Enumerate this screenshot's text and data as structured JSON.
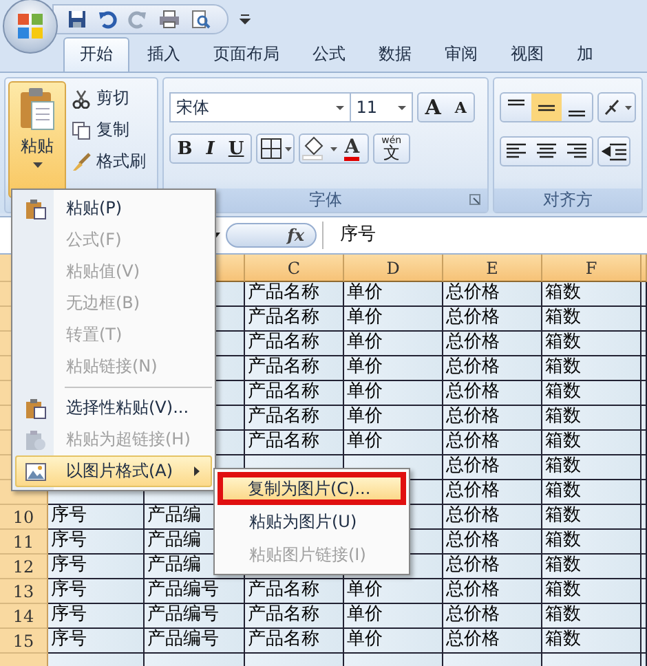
{
  "tabs": [
    {
      "label": "开始",
      "selected": true
    },
    {
      "label": "插入",
      "selected": false
    },
    {
      "label": "页面布局",
      "selected": false
    },
    {
      "label": "公式",
      "selected": false
    },
    {
      "label": "数据",
      "selected": false
    },
    {
      "label": "审阅",
      "selected": false
    },
    {
      "label": "视图",
      "selected": false
    },
    {
      "label": "加",
      "selected": false
    }
  ],
  "clipboard": {
    "paste": "粘贴",
    "tools": [
      {
        "label": "剪切",
        "kind": "cut"
      },
      {
        "label": "复制",
        "kind": "copy"
      },
      {
        "label": "格式刷",
        "kind": "brush"
      }
    ]
  },
  "font": {
    "name": "宋体",
    "size": "11",
    "grow": "A",
    "shrink": "A",
    "bold": "B",
    "italic": "I",
    "underline": "U",
    "color_letter": "A",
    "phonetic_top": "wén",
    "phonetic": "文",
    "label": "字体"
  },
  "alignment": {
    "label": "对齐方"
  },
  "formula_bar": {
    "fx": "fx",
    "content": "序号"
  },
  "columns": [
    null,
    null,
    "C",
    "D",
    "E",
    "F"
  ],
  "rows": [
    {
      "number": null,
      "cells": [
        null,
        null,
        "产品名称",
        "单价",
        "总价格",
        "箱数"
      ]
    },
    {
      "number": null,
      "cells": [
        null,
        null,
        "产品名称",
        "单价",
        "总价格",
        "箱数"
      ]
    },
    {
      "number": null,
      "cells": [
        null,
        null,
        "产品名称",
        "单价",
        "总价格",
        "箱数"
      ]
    },
    {
      "number": null,
      "cells": [
        null,
        null,
        "产品名称",
        "单价",
        "总价格",
        "箱数"
      ]
    },
    {
      "number": null,
      "cells": [
        null,
        null,
        "产品名称",
        "单价",
        "总价格",
        "箱数"
      ]
    },
    {
      "number": null,
      "cells": [
        null,
        null,
        "产品名称",
        "单价",
        "总价格",
        "箱数"
      ]
    },
    {
      "number": null,
      "cells": [
        null,
        null,
        "产品名称",
        "单价",
        "总价格",
        "箱数"
      ]
    },
    {
      "number": null,
      "cells": [
        null,
        null,
        null,
        null,
        "总价格",
        "箱数"
      ]
    },
    {
      "number": null,
      "cells": [
        null,
        null,
        null,
        null,
        "总价格",
        "箱数"
      ]
    },
    {
      "number": "10",
      "cells": [
        "序号",
        "产品编",
        null,
        null,
        "总价格",
        "箱数"
      ]
    },
    {
      "number": "11",
      "cells": [
        "序号",
        "产品编",
        null,
        null,
        "总价格",
        "箱数"
      ]
    },
    {
      "number": "12",
      "cells": [
        "序号",
        "产品编",
        null,
        null,
        "总价格",
        "箱数"
      ]
    },
    {
      "number": "13",
      "cells": [
        "序号",
        "产品编号",
        "产品名称",
        "单价",
        "总价格",
        "箱数"
      ]
    },
    {
      "number": "14",
      "cells": [
        "序号",
        "产品编号",
        "产品名称",
        "单价",
        "总价格",
        "箱数"
      ]
    },
    {
      "number": "15",
      "cells": [
        "序号",
        "产品编号",
        "产品名称",
        "单价",
        "总价格",
        "箱数"
      ]
    }
  ],
  "paste_menu": [
    {
      "label": "粘贴(P)",
      "kind": "paste",
      "disabled": false,
      "selected": false,
      "separator_before": false
    },
    {
      "label": "公式(F)",
      "kind": "plain",
      "disabled": true,
      "selected": false,
      "separator_before": false
    },
    {
      "label": "粘贴值(V)",
      "kind": "plain",
      "disabled": true,
      "selected": false,
      "separator_before": false
    },
    {
      "label": "无边框(B)",
      "kind": "plain",
      "disabled": true,
      "selected": false,
      "separator_before": false
    },
    {
      "label": "转置(T)",
      "kind": "plain",
      "disabled": true,
      "selected": false,
      "separator_before": false
    },
    {
      "label": "粘贴链接(N)",
      "kind": "plain",
      "disabled": true,
      "selected": false,
      "separator_before": false
    },
    {
      "label": "选择性粘贴(V)...",
      "kind": "paste",
      "disabled": false,
      "selected": false,
      "separator_before": true
    },
    {
      "label": "粘贴为超链接(H)",
      "kind": "link",
      "disabled": true,
      "selected": false,
      "separator_before": false
    },
    {
      "label": "以图片格式(A)",
      "kind": "picture",
      "disabled": false,
      "selected": true,
      "separator_before": false
    }
  ],
  "picture_submenu": [
    {
      "label": "复制为图片(C)...",
      "disabled": false,
      "selected": true,
      "annotated": true
    },
    {
      "label": "粘贴为图片(U)",
      "disabled": false,
      "selected": false,
      "annotated": false
    },
    {
      "label": "粘贴图片链接(I)",
      "disabled": true,
      "selected": false,
      "annotated": false
    }
  ]
}
